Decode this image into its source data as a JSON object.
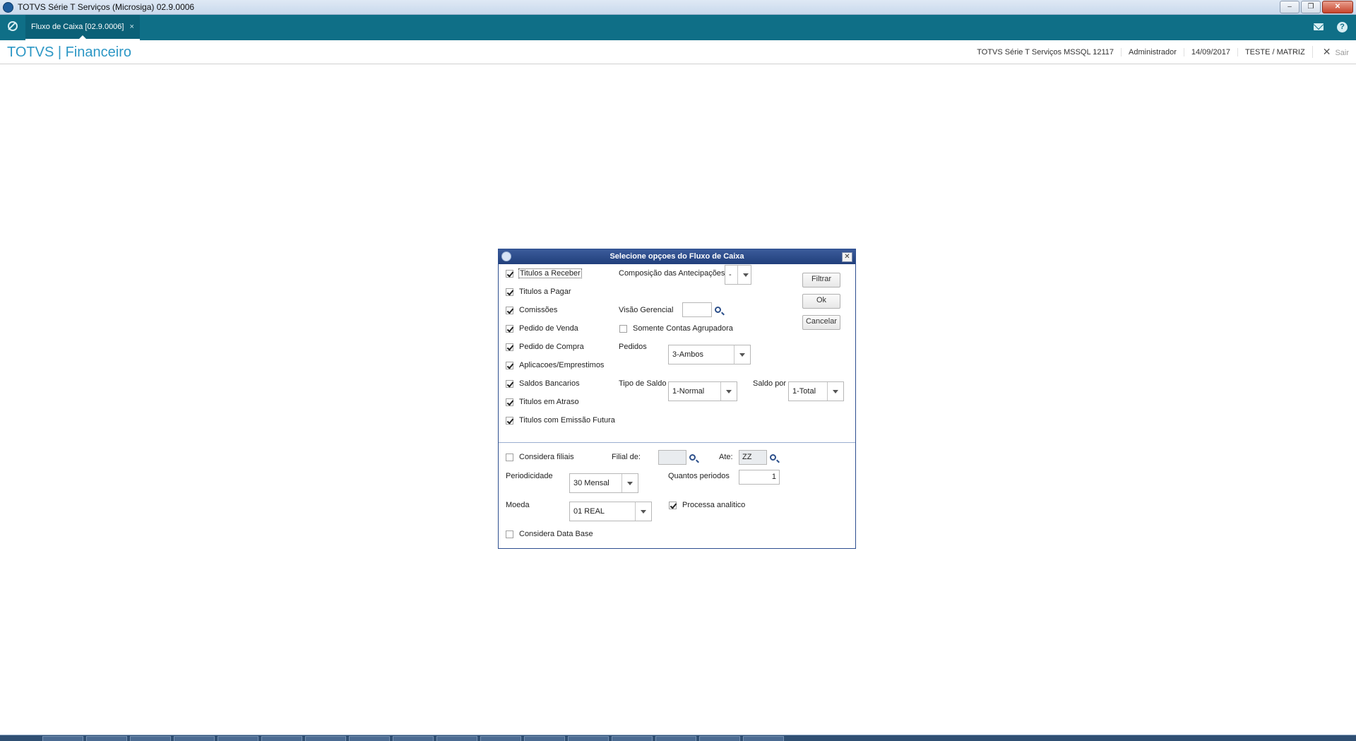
{
  "window": {
    "title": "TOTVS Série T Serviços (Microsiga) 02.9.0006"
  },
  "tabs": [
    {
      "label": "Fluxo de Caixa [02.9.0006]",
      "close": "×"
    }
  ],
  "header": {
    "brand": "TOTVS | Financeiro",
    "environment": "TOTVS Série T Serviços MSSQL 12117",
    "user": "Administrador",
    "date": "14/09/2017",
    "company": "TESTE / MATRIZ",
    "exit_label": "Sair",
    "help_label": "?"
  },
  "dialog": {
    "title": "Selecione opçoes do Fluxo de Caixa",
    "checkboxes": [
      {
        "label": "Titulos a Receber",
        "checked": true
      },
      {
        "label": "Titulos a Pagar",
        "checked": true
      },
      {
        "label": "Comissões",
        "checked": true
      },
      {
        "label": "Pedido de Venda",
        "checked": true
      },
      {
        "label": "Pedido de Compra",
        "checked": true
      },
      {
        "label": "Aplicacoes/Emprestimos",
        "checked": true
      },
      {
        "label": "Saldos Bancarios",
        "checked": true
      },
      {
        "label": "Titulos em Atraso",
        "checked": true
      },
      {
        "label": "Titulos com Emissão Futura",
        "checked": true
      }
    ],
    "composicao": {
      "label": "Composição das Antecipações",
      "value": "-"
    },
    "visao": {
      "label": "Visão Gerencial",
      "value": ""
    },
    "somente": {
      "label": "Somente Contas Agrupadora",
      "checked": false
    },
    "pedidos": {
      "label": "Pedidos",
      "value": "3-Ambos"
    },
    "tipo_saldo": {
      "label": "Tipo de Saldo",
      "value": "1-Normal"
    },
    "saldo_por": {
      "label": "Saldo por",
      "value": "1-Total"
    },
    "buttons": {
      "filtrar": "Filtrar",
      "ok": "Ok",
      "cancelar": "Cancelar"
    },
    "considera_filiais": {
      "label": "Considera filiais",
      "checked": false
    },
    "filial_de": {
      "label": "Filial de:",
      "value": ""
    },
    "ate": {
      "label": "Ate:",
      "value": "ZZ"
    },
    "periodicidade": {
      "label": "Periodicidade",
      "value": "30 Mensal"
    },
    "quantos": {
      "label": "Quantos periodos",
      "value": "1"
    },
    "moeda": {
      "label": "Moeda",
      "value": "01 REAL"
    },
    "processa": {
      "label": "Processa analitico",
      "checked": true
    },
    "data_base": {
      "label": "Considera Data Base",
      "checked": false
    }
  },
  "colors": {
    "tabstrip": "#0f6f87",
    "brand": "#2c97c5",
    "dialog_title": "#213f7b"
  }
}
